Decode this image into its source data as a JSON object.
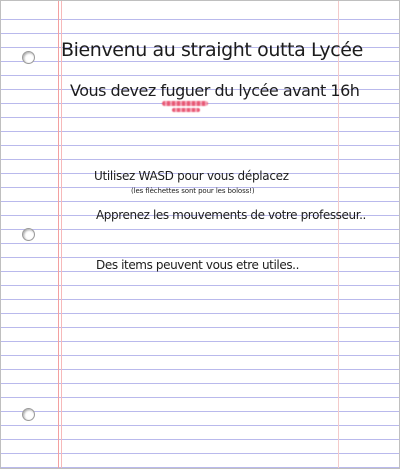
{
  "title": "Bienvenu au straight outta Lycée",
  "subtitle": {
    "before": "Vous devez ",
    "misspelled": "fuguer",
    "after": " du lycée avant 16h"
  },
  "instructions": {
    "controls": "Utilisez WASD pour vous déplacez",
    "arrows_note": "(les flèchettes sont pour les boloss!)",
    "teacher": "Apprenez les mouvements de votre professeur..",
    "items": "Des items peuvent vous etre utiles.."
  },
  "colors": {
    "paper": "#ffffff",
    "ruled_line": "#b9b9ec",
    "margin_line": "#f3a0a0",
    "ink": "#1c1c1c",
    "spellcheck_underline": "#e8506e"
  }
}
